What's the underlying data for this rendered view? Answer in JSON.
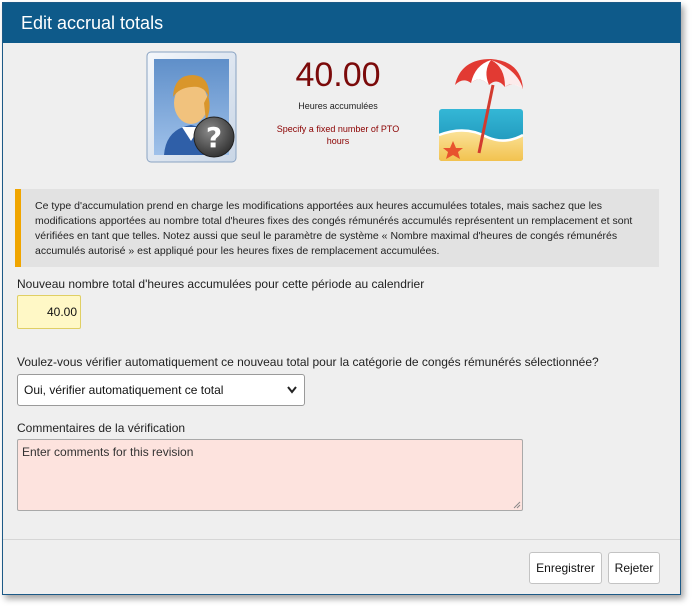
{
  "dialog": {
    "title": "Edit accrual totals"
  },
  "summary": {
    "total_value": "40.00",
    "total_label": "Heures accumulées",
    "hint": "Specify a fixed number of PTO hours",
    "avatar_icon": "user-question-icon",
    "beach_icon": "beach-umbrella-icon"
  },
  "notice": {
    "text": "Ce type d'accumulation prend en charge les modifications apportées aux heures accumulées totales, mais sachez que les modifications apportées au nombre total d'heures fixes des congés rémunérés accumulés représentent un remplacement et sont vérifiées en tant que telles. Notez aussi que seul le paramètre de système « Nombre maximal d'heures de congés rémunérés accumulés autorisé » est appliqué pour les heures fixes de remplacement accumulées."
  },
  "form": {
    "total_label": "Nouveau nombre total d'heures accumulées pour cette période au calendrier",
    "total_value": "40.00",
    "verify_label": "Voulez-vous vérifier automatiquement ce nouveau total pour la catégorie de congés rémunérés sélectionnée?",
    "verify_selected": "Oui, vérifier automatiquement ce total",
    "comments_label": "Commentaires de la vérification",
    "comments_placeholder": "Enter comments for this revision"
  },
  "buttons": {
    "save": "Enregistrer",
    "reject": "Rejeter"
  },
  "colors": {
    "titlebar": "#0e5a8a",
    "total_value": "#7b0a0a",
    "notice_accent": "#f0a500",
    "input_highlight": "#fff8c6",
    "comments_bg": "#fde3de"
  }
}
